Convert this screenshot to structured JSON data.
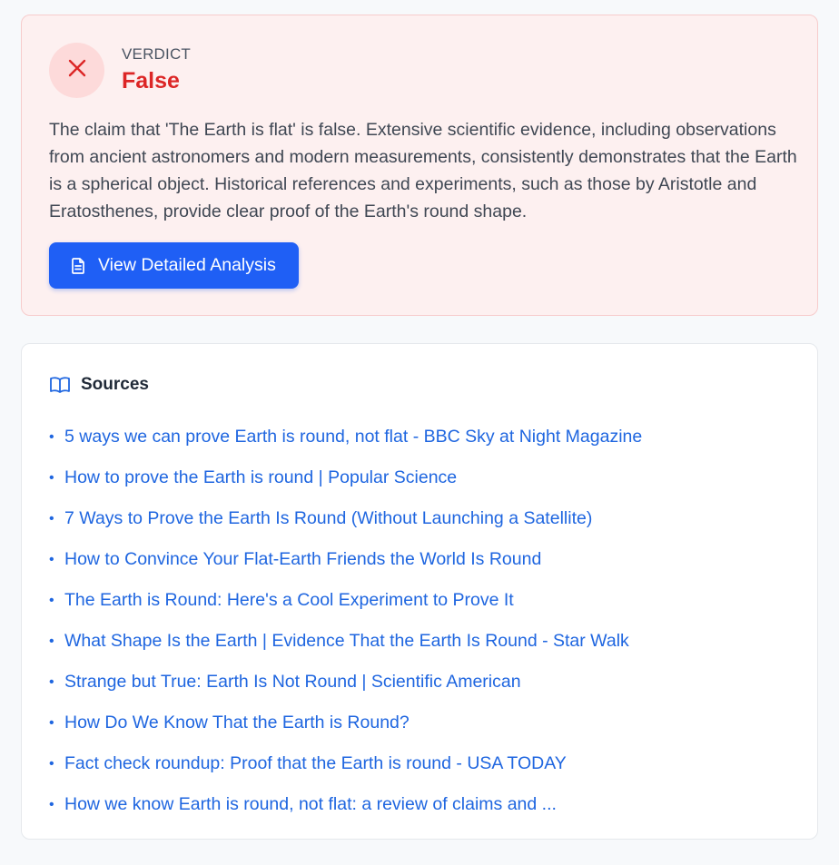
{
  "verdict": {
    "label": "VERDICT",
    "value": "False",
    "explanation": "The claim that 'The Earth is flat' is false. Extensive scientific evidence, including observations from ancient astronomers and modern measurements, consistently demonstrates that the Earth is a spherical object. Historical references and experiments, such as those by Aristotle and Eratosthenes, provide clear proof of the Earth's round shape.",
    "icon": "close-icon",
    "color": "#dc2626",
    "button_label": "View Detailed Analysis",
    "button_icon": "document-icon"
  },
  "sources": {
    "title": "Sources",
    "icon": "book-icon",
    "items": [
      {
        "label": "5 ways we can prove Earth is round, not flat - BBC Sky at Night Magazine"
      },
      {
        "label": "How to prove the Earth is round | Popular Science"
      },
      {
        "label": "7 Ways to Prove the Earth Is Round (Without Launching a Satellite)"
      },
      {
        "label": "How to Convince Your Flat-Earth Friends the World Is Round"
      },
      {
        "label": "The Earth is Round: Here's a Cool Experiment to Prove It"
      },
      {
        "label": "What Shape Is the Earth | Evidence That the Earth Is Round - Star Walk"
      },
      {
        "label": "Strange but True: Earth Is Not Round | Scientific American"
      },
      {
        "label": "How Do We Know That the Earth is Round?"
      },
      {
        "label": "Fact check roundup: Proof that the Earth is round - USA TODAY"
      },
      {
        "label": "How we know Earth is round, not flat: a review of claims and ..."
      }
    ]
  },
  "colors": {
    "accent": "#1f5ff5",
    "link": "#1f66e0",
    "false_red": "#dc2626"
  }
}
